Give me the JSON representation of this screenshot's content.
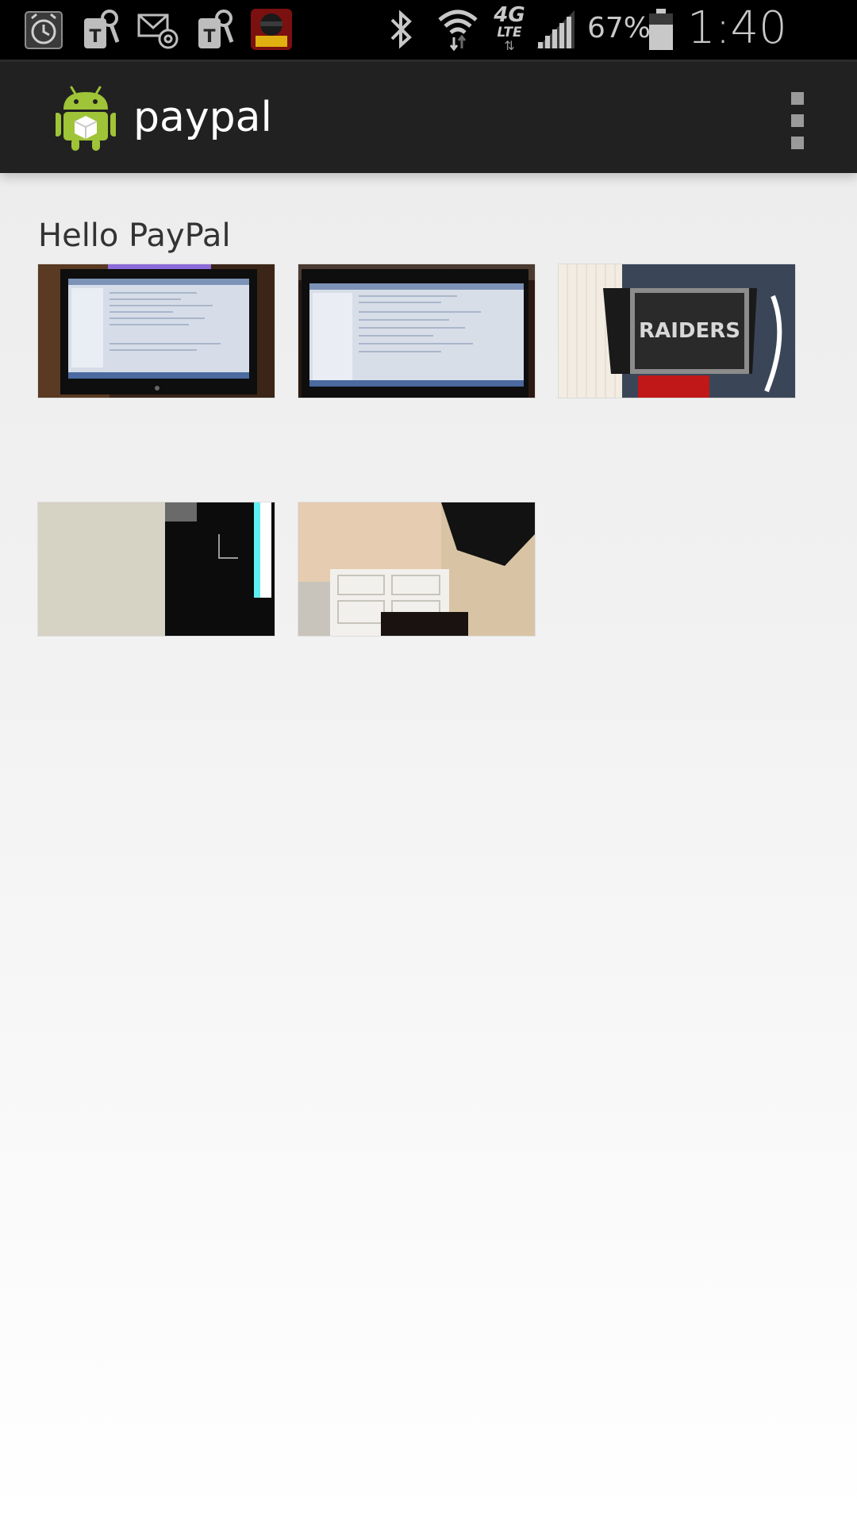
{
  "status_bar": {
    "icons": [
      "alarm-icon",
      "tmobile-key-icon",
      "email-at-icon",
      "tmobile-key-icon",
      "angry-birds-star-wars-icon",
      "bluetooth-icon",
      "wifi-icon",
      "lte-4g-icon",
      "signal-icon",
      "battery-icon"
    ],
    "network": "4G",
    "network_sub": "LTE",
    "battery": "67%",
    "time": "1:40 PM"
  },
  "action_bar": {
    "title": "paypal",
    "logo": "android-robot-icon",
    "overflow": "overflow-menu-icon"
  },
  "content": {
    "heading": "Hello PayPal",
    "thumbnails": [
      {
        "subject": "laptop with IDE"
      },
      {
        "subject": "laptop with IDE"
      },
      {
        "subject": "black tumbler with team logo"
      },
      {
        "subject": "wall, chair and screen"
      },
      {
        "subject": "door and carpeted floor"
      }
    ]
  },
  "colors": {
    "status_bar": "#000000",
    "action_bar": "#212121",
    "title_text": "#ffffff",
    "heading_text": "#333333",
    "android_green": "#9fc437"
  }
}
